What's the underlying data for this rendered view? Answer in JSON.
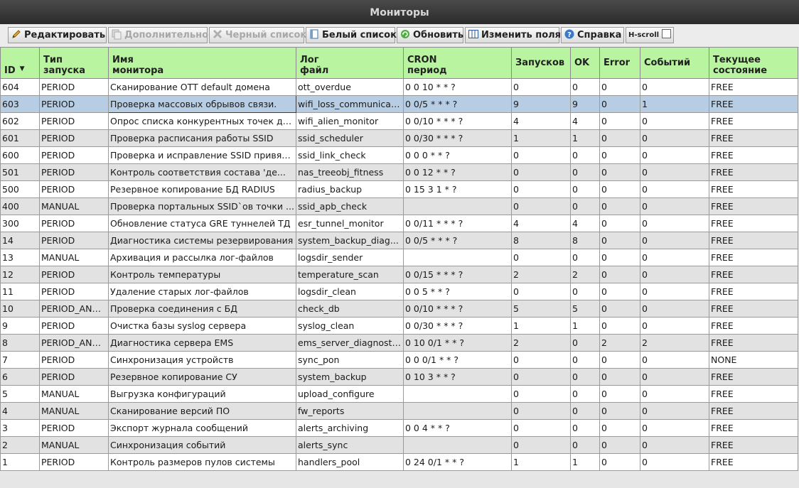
{
  "window": {
    "title": "Мониторы"
  },
  "toolbar": {
    "edit": "Редактировать",
    "extra": "Дополнительно",
    "blacklist": "Черный список",
    "whitelist": "Белый список",
    "refresh": "Обновить",
    "fields": "Изменить поля",
    "help": "Справка",
    "hscroll": "H-scroll"
  },
  "columns": [
    "ID",
    "Тип запуска",
    "Имя монитора",
    "Лог файл",
    "CRON период",
    "Запусков",
    "OK",
    "Error",
    "Событий",
    "Текущее состояние"
  ],
  "header": {
    "id": "ID",
    "type_1": "Тип",
    "type_2": "запуска",
    "name_1": "Имя",
    "name_2": "монитора",
    "log_1": "Лог",
    "log_2": "файл",
    "cron_1": "CRON",
    "cron_2": "период",
    "runs": "Запусков",
    "ok": "OK",
    "error": "Error",
    "events": "Событий",
    "state_1": "Текущее",
    "state_2": "состояние"
  },
  "selected_row": 1,
  "rows": [
    [
      "604",
      "PERIOD",
      "Сканирование OTT default домена",
      "ott_overdue",
      "0 0 10 * * ?",
      "0",
      "0",
      "0",
      "0",
      "FREE"
    ],
    [
      "603",
      "PERIOD",
      "Проверка массовых обрывов связи.",
      "wifi_loss_communicati...",
      "0 0/5 * * * ?",
      "9",
      "9",
      "0",
      "1",
      "FREE"
    ],
    [
      "602",
      "PERIOD",
      "Опрос списка конкурентных точек до...",
      "wifi_alien_monitor",
      "0 0/10 * * * ?",
      "4",
      "4",
      "0",
      "0",
      "FREE"
    ],
    [
      "601",
      "PERIOD",
      "Проверка расписания работы SSID",
      "ssid_scheduler",
      "0 0/30 * * * ?",
      "1",
      "1",
      "0",
      "0",
      "FREE"
    ],
    [
      "600",
      "PERIOD",
      "Проверка и исправление SSID привязок",
      "ssid_link_check",
      "0 0 0 * * ?",
      "0",
      "0",
      "0",
      "0",
      "FREE"
    ],
    [
      "501",
      "PERIOD",
      "Контроль соответствия состава 'де...",
      "nas_treeobj_fitness",
      "0 0 12 * * ?",
      "0",
      "0",
      "0",
      "0",
      "FREE"
    ],
    [
      "500",
      "PERIOD",
      "Резервное копирование БД RADIUS",
      "radius_backup",
      "0 15 3 1 * ?",
      "0",
      "0",
      "0",
      "0",
      "FREE"
    ],
    [
      "400",
      "MANUAL",
      "Проверка портальных SSID`ов точки ...",
      "ssid_apb_check",
      "",
      "0",
      "0",
      "0",
      "0",
      "FREE"
    ],
    [
      "300",
      "PERIOD",
      "Обновление статуса GRE туннелей ТД",
      "esr_tunnel_monitor",
      "0 0/11 * * * ?",
      "4",
      "4",
      "0",
      "0",
      "FREE"
    ],
    [
      "14",
      "PERIOD",
      "Диагностика системы резервирования",
      "system_backup_diag...",
      "0 0/5 * * * ?",
      "8",
      "8",
      "0",
      "0",
      "FREE"
    ],
    [
      "13",
      "MANUAL",
      "Архивация и рассылка лог-файлов",
      "logsdir_sender",
      "",
      "0",
      "0",
      "0",
      "0",
      "FREE"
    ],
    [
      "12",
      "PERIOD",
      "Контроль температуры",
      "temperature_scan",
      "0 0/15 * * * ?",
      "2",
      "2",
      "0",
      "0",
      "FREE"
    ],
    [
      "11",
      "PERIOD",
      "Удаление старых лог-файлов",
      "logsdir_clean",
      "0 0 5 * * ?",
      "0",
      "0",
      "0",
      "0",
      "FREE"
    ],
    [
      "10",
      "PERIOD_AND...",
      "Проверка соединения с БД",
      "check_db",
      "0 0/10 * * * ?",
      "5",
      "5",
      "0",
      "0",
      "FREE"
    ],
    [
      "9",
      "PERIOD",
      "Очистка базы syslog сервера",
      "syslog_clean",
      "0 0/30 * * * ?",
      "1",
      "1",
      "0",
      "0",
      "FREE"
    ],
    [
      "8",
      "PERIOD_AND...",
      "Диагностика сервера EMS",
      "ems_server_diagnosti...",
      "0 10 0/1 * * ?",
      "2",
      "0",
      "2",
      "2",
      "FREE"
    ],
    [
      "7",
      "PERIOD",
      "Синхронизация устройств",
      "sync_pon",
      "0 0 0/1 * * ?",
      "0",
      "0",
      "0",
      "0",
      "NONE"
    ],
    [
      "6",
      "PERIOD",
      "Резервное копирование СУ",
      "system_backup",
      "0 10 3 * * ?",
      "0",
      "0",
      "0",
      "0",
      "FREE"
    ],
    [
      "5",
      "MANUAL",
      "Выгрузка конфигураций",
      "upload_configure",
      "",
      "0",
      "0",
      "0",
      "0",
      "FREE"
    ],
    [
      "4",
      "MANUAL",
      "Сканирование версий ПО",
      "fw_reports",
      "",
      "0",
      "0",
      "0",
      "0",
      "FREE"
    ],
    [
      "3",
      "PERIOD",
      "Экспорт журнала сообщений",
      "alerts_archiving",
      "0 0 4 * * ?",
      "0",
      "0",
      "0",
      "0",
      "FREE"
    ],
    [
      "2",
      "MANUAL",
      "Синхронизация событий",
      "alerts_sync",
      "",
      "0",
      "0",
      "0",
      "0",
      "FREE"
    ],
    [
      "1",
      "PERIOD",
      "Контроль размеров пулов системы",
      "handlers_pool",
      "0 24 0/1 * * ?",
      "1",
      "1",
      "0",
      "0",
      "FREE"
    ]
  ],
  "colors": {
    "header_bg": "#b9f5a0",
    "selected_row": "#b7cde3",
    "alt_row": "#e2e2e2",
    "titlebar": "#333333"
  },
  "icons": [
    "pencil-icon",
    "copy-icon",
    "cross-icon",
    "whitelist-icon",
    "refresh-icon",
    "columns-icon",
    "help-icon"
  ]
}
